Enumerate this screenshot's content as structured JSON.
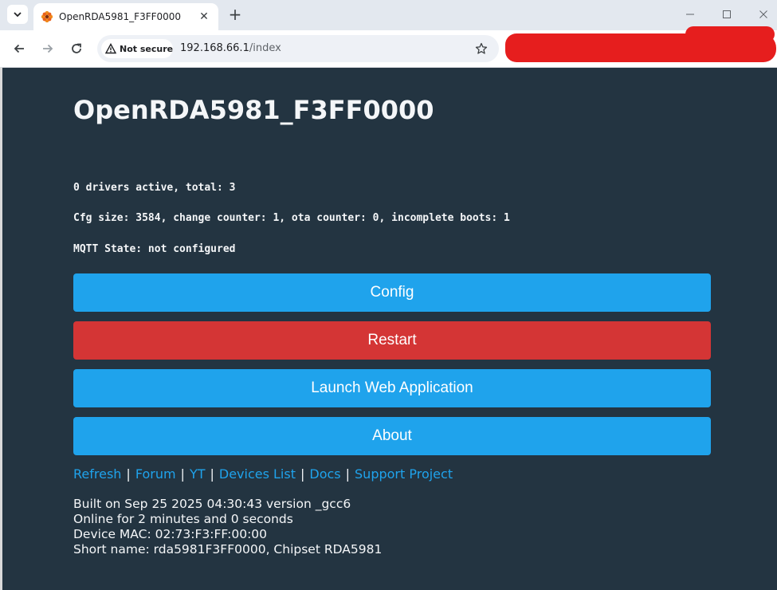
{
  "browser": {
    "tab_title": "OpenRDA5981_F3FF0000",
    "tab_close": "✕",
    "new_tab": "+",
    "security_label": "Not secure",
    "url_host": "192.168.66.1",
    "url_path": "/index",
    "icons": {
      "tab_dropdown": "chevron-down-icon",
      "favicon": "flower-icon",
      "back": "back-arrow-icon",
      "forward": "forward-arrow-icon",
      "reload": "reload-icon",
      "warning": "warning-icon",
      "bookmark": "star-icon",
      "minimize": "minimize-icon",
      "maximize": "maximize-icon",
      "close": "close-icon"
    },
    "colors": {
      "redaction": "#e61e1e"
    }
  },
  "page": {
    "title": "OpenRDA5981_F3FF0000",
    "status_lines": [
      "0 drivers active, total: 3",
      "Cfg size: 3584, change counter: 1, ota counter: 0, incomplete boots: 1",
      "MQTT State: not configured"
    ],
    "buttons": [
      {
        "label": "Config",
        "color": "#1fa3ec"
      },
      {
        "label": "Restart",
        "color": "#d43535"
      },
      {
        "label": "Launch Web Application",
        "color": "#1fa3ec"
      },
      {
        "label": "About",
        "color": "#1fa3ec"
      }
    ],
    "links": [
      "Refresh",
      "Forum",
      "YT",
      "Devices List",
      "Docs",
      "Support Project"
    ],
    "link_separator": "|",
    "footer_lines": [
      "Built on Sep 25 2025 04:30:43 version _gcc6",
      "Online for 2 minutes and 0 seconds",
      "Device MAC: 02:73:F3:FF:00:00",
      "Short name: rda5981F3FF0000, Chipset RDA5981"
    ],
    "colors": {
      "background": "#233441",
      "link": "#1fa3ec",
      "text": "#f4f6f8"
    }
  }
}
